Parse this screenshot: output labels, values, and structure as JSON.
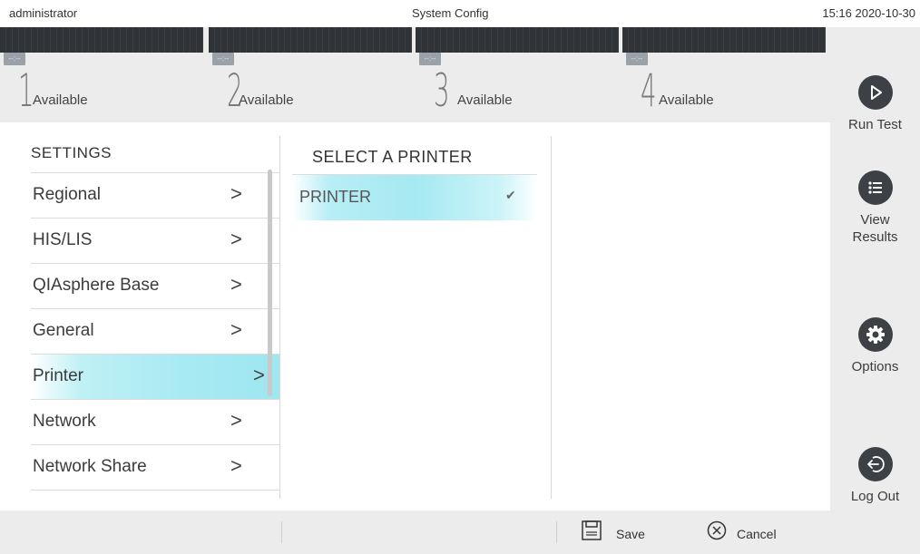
{
  "topbar": {
    "user": "administrator",
    "title": "System Config",
    "clock": "15:16 2020-10-30"
  },
  "modules": [
    {
      "number": "1",
      "tag": "--:--",
      "status": "Available"
    },
    {
      "number": "2",
      "tag": "--:--",
      "status": "Available"
    },
    {
      "number": "3",
      "tag": "--:--",
      "status": "Available"
    },
    {
      "number": "4",
      "tag": "--:--",
      "status": "Available"
    }
  ],
  "sidebar": {
    "run_test": "Run Test",
    "view_results": "View\nResults",
    "options": "Options",
    "log_out": "Log Out"
  },
  "settings": {
    "heading": "SETTINGS",
    "items": [
      {
        "label": "Regional"
      },
      {
        "label": "HIS/LIS"
      },
      {
        "label": "QIAsphere Base"
      },
      {
        "label": "General"
      },
      {
        "label": "Printer",
        "selected": true
      },
      {
        "label": "Network"
      },
      {
        "label": "Network Share"
      }
    ]
  },
  "printer": {
    "heading": "SELECT A PRINTER",
    "selected": "PRINTER"
  },
  "bottom": {
    "save": "Save",
    "cancel": "Cancel"
  },
  "colors": {
    "accent_selected": "#a8eaf3",
    "sidebar_bg": "#ececec",
    "icon_circle": "#3d4045"
  }
}
